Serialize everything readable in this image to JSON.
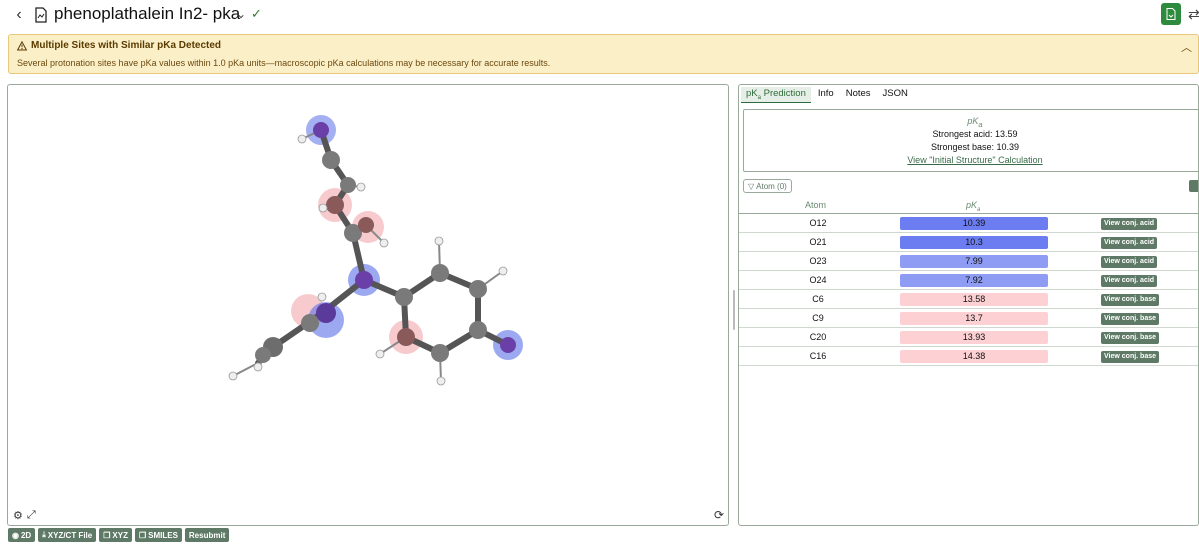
{
  "header": {
    "title": "phenoplathalein In2- pka",
    "chevron": "⌄",
    "check": "✓",
    "back_glyph": "‹"
  },
  "warning": {
    "title": "Multiple Sites with Similar pKa Detected",
    "message": "Several protonation sites have pKa values within 1.0 pKa units—macroscopic pKa calculations may be necessary for accurate results.",
    "icon": "warning-triangle-icon",
    "bg_color": "#fbefc8"
  },
  "viewer": {
    "icons": [
      "gear-icon",
      "expand-icon",
      "refresh-icon"
    ]
  },
  "toolbar": {
    "buttons": [
      "2D",
      "XYZ/CT File",
      "XYZ",
      "SMILES",
      "Resubmit"
    ]
  },
  "panel": {
    "tabs": [
      {
        "label": "pK",
        "sub": "a",
        "suffix": " Prediction",
        "active": true
      },
      {
        "label": "Info"
      },
      {
        "label": "Notes"
      },
      {
        "label": "JSON"
      }
    ],
    "summary": {
      "heading": "pK",
      "heading_sub": "a",
      "strongest_acid": "Strongest acid: 13.59",
      "strongest_base": "Strongest base: 10.39",
      "link": "View \"Initial Structure\" Calculation"
    },
    "filter_chip": "Atom (0)",
    "table": {
      "col_atom": "Atom",
      "col_pka": "pK",
      "col_pka_sub": "a",
      "rows": [
        {
          "atom": "O12",
          "pka": "10.39",
          "action": "View conj. acid",
          "color": "#6b7df0"
        },
        {
          "atom": "O21",
          "pka": "10.3",
          "action": "View conj. acid",
          "color": "#6b7df0"
        },
        {
          "atom": "O23",
          "pka": "7.99",
          "action": "View conj. acid",
          "color": "#8f9cf3"
        },
        {
          "atom": "O24",
          "pka": "7.92",
          "action": "View conj. acid",
          "color": "#8f9cf3"
        },
        {
          "atom": "C6",
          "pka": "13.58",
          "action": "View conj. base",
          "color": "#fdd0d3"
        },
        {
          "atom": "C9",
          "pka": "13.7",
          "action": "View conj. base",
          "color": "#fdd0d3"
        },
        {
          "atom": "C20",
          "pka": "13.93",
          "action": "View conj. base",
          "color": "#fdd0d3"
        },
        {
          "atom": "C16",
          "pka": "14.38",
          "action": "View conj. base",
          "color": "#fdd0d3"
        }
      ]
    }
  },
  "accent_color": "#5e7a66"
}
